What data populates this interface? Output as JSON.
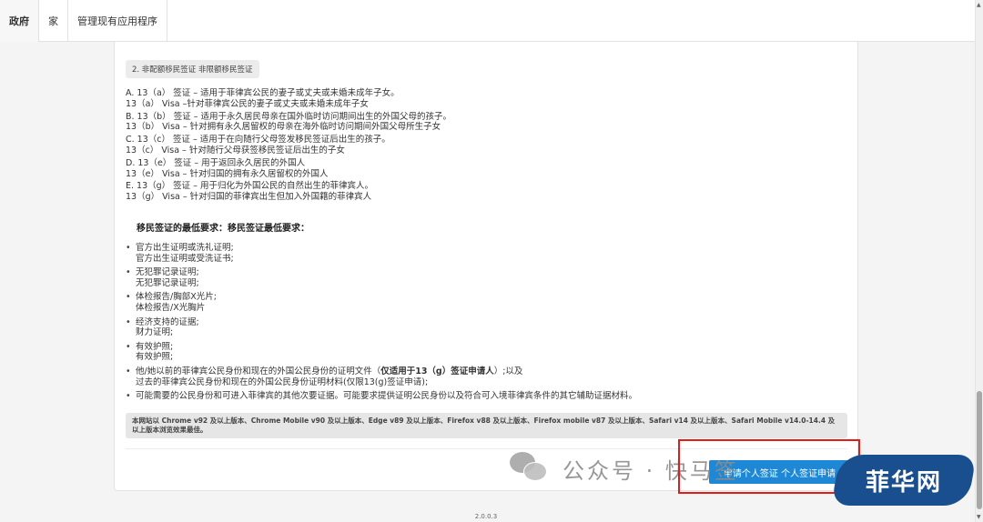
{
  "nav": {
    "tabs": [
      {
        "label": "政府"
      },
      {
        "label": "家"
      },
      {
        "label": "管理现有应用程序"
      }
    ]
  },
  "section": {
    "chip": "2. 非配额移民签证 非限额移民签证"
  },
  "visas": [
    {
      "line1": "A. 13（a） 签证 – 适用于菲律宾公民的妻子或丈夫或未婚未成年子女。",
      "line2": "13（a） Visa –针对菲律宾公民的妻子或丈夫或未婚未成年子女"
    },
    {
      "line1": "B. 13（b） 签证 – 适用于永久居民母亲在国外临时访问期间出生的外国父母的孩子。",
      "line2": "13（b） Visa – 针对拥有永久居留权的母亲在海外临时访问期间外国父母所生子女"
    },
    {
      "line1": "C. 13（c） 签证 – 适用于在向随行父母签发移民签证后出生的孩子。",
      "line2": "13（c） Visa – 针对随行父母获签移民签证后出生的子女"
    },
    {
      "line1": "D. 13（e） 签证 – 用于返回永久居民的外国人",
      "line2": "13（e） Visa – 针对归国的拥有永久居留权的外国人"
    },
    {
      "line1": "E. 13（g） 签证 – 用于归化为外国公民的自然出生的菲律宾人。",
      "line2": "13（g） Visa – 针对归国的菲律宾出生但加入外国籍的菲律宾人"
    }
  ],
  "requirements": {
    "title": "移民签证的最低要求：移民签证最低要求：",
    "items": [
      {
        "line1": "官方出生证明或洗礼证明;",
        "line2": "官方出生证明或受洗证书;"
      },
      {
        "line1": "无犯罪记录证明;",
        "line2": "无犯罪记录证明;"
      },
      {
        "line1": "体检报告/胸部X光片;",
        "line2": "体检报告/X光胸片"
      },
      {
        "line1": "经济支持的证据;",
        "line2": "财力证明;"
      },
      {
        "line1": "有效护照;",
        "line2": "有效护照;"
      }
    ],
    "proof_prefix": "他/她以前的菲律宾公民身份和现在的外国公民身份的证明文件（",
    "proof_bold": "仅适用于13（g）签证申请人",
    "proof_suffix": "）;以及",
    "proof_line2": "过去的菲律宾公民身份和现在的外国公民身份证明材料(仅限13(g)签证申请);",
    "extra": "可能需要的公民身份和可进入菲律宾的其他次要证据。可能要求提供证明公民身份以及符合可入境菲律宾条件的其它辅助证据材料。"
  },
  "browser_note": "本网站以 Chrome v92 及以上版本、Chrome Mobile v90 及以上版本、Edge v89 及以上版本、Firefox v88 及以上版本、Firefox mobile v87 及以上版本、Safari v14 及以上版本、Safari Mobile v14.0-14.4 及以上版本浏览效果最佳。",
  "apply_button": "申请个人签证 个人签证申请",
  "watermark": {
    "text": "公众号 · 快马签",
    "site": "菲华网"
  },
  "version": "2.0.0.3",
  "colors": {
    "primary": "#1e88d6",
    "highlight": "#e21b1b",
    "badge": "#1a4f8f"
  }
}
